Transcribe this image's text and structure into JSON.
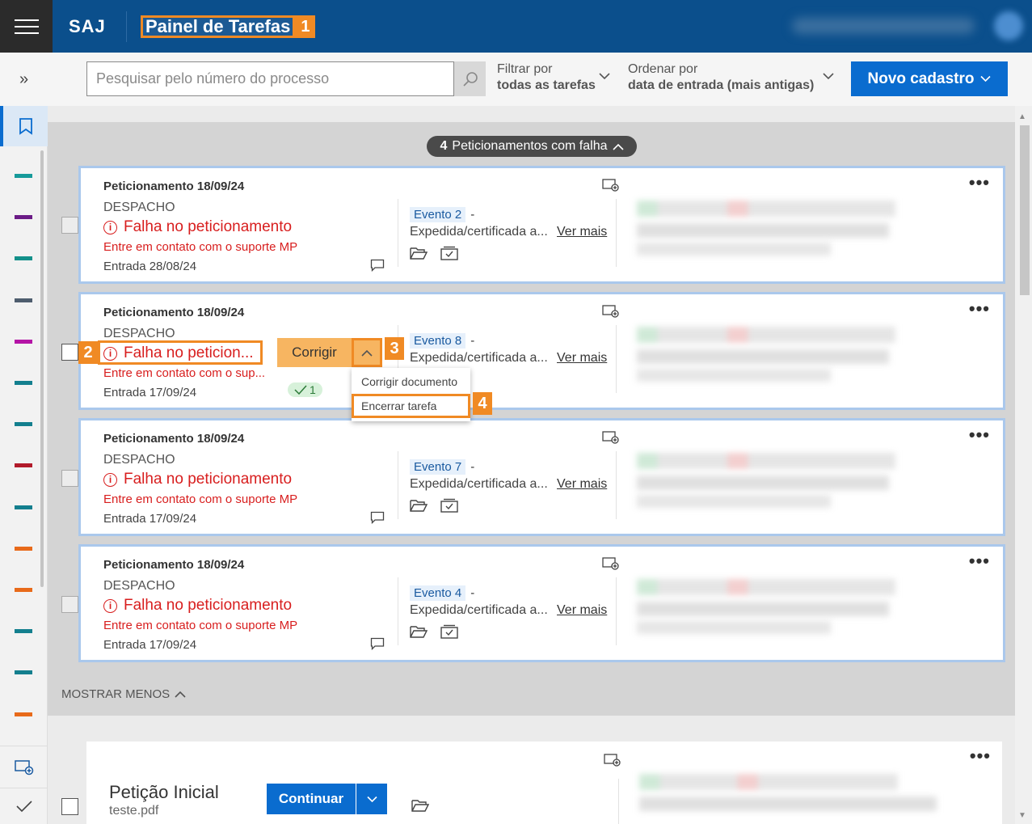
{
  "header": {
    "brand": "SAJ",
    "title": "Painel de Tarefas",
    "title_badge": "1"
  },
  "toolbar": {
    "search_placeholder": "Pesquisar pelo número do processo",
    "filter_label": "Filtrar por",
    "filter_value": "todas as tarefas",
    "order_label": "Ordenar por",
    "order_value": "data de entrada (mais antigas)",
    "new_button": "Novo cadastro"
  },
  "failures_pill": {
    "count": "4",
    "label": "Peticionamentos com falha"
  },
  "cards": [
    {
      "title": "Peticionamento 18/09/24",
      "type": "DESPACHO",
      "error": "Falha no peticionamento",
      "support": "Entre em contato com o suporte MP",
      "entry": "Entrada 28/08/24",
      "event": "Evento 2",
      "description": "Expedida/certificada a...",
      "more": "Ver mais"
    },
    {
      "title": "Peticionamento 18/09/24",
      "type": "DESPACHO",
      "error": "Falha no peticion...",
      "support": "Entre em contato com o sup...",
      "entry": "Entrada 17/09/24",
      "badge": "1",
      "event": "Evento 8",
      "description": "Expedida/certificada a...",
      "more": "Ver mais"
    },
    {
      "title": "Peticionamento 18/09/24",
      "type": "DESPACHO",
      "error": "Falha no peticionamento",
      "support": "Entre em contato com o suporte MP",
      "entry": "Entrada 17/09/24",
      "event": "Evento 7",
      "description": "Expedida/certificada a...",
      "more": "Ver mais"
    },
    {
      "title": "Peticionamento 18/09/24",
      "type": "DESPACHO",
      "error": "Falha no peticionamento",
      "support": "Entre em contato com o suporte MP",
      "entry": "Entrada 17/09/24",
      "event": "Evento 4",
      "description": "Expedida/certificada a...",
      "more": "Ver mais"
    }
  ],
  "step_badges": {
    "two": "2",
    "three": "3",
    "four": "4"
  },
  "corrigir": {
    "label": "Corrigir",
    "menu": [
      "Corrigir documento",
      "Encerrar tarefa"
    ]
  },
  "show_less": "MOSTRAR MENOS",
  "petition": {
    "title": "Petição Inicial",
    "file": "teste.pdf",
    "continue": "Continuar"
  },
  "sidebar": {
    "colors": [
      "#169a9a",
      "#6b1b86",
      "#13908a",
      "#4e5d6e",
      "#b514a6",
      "#137f8e",
      "#137f8e",
      "#b21b2b",
      "#137f8e",
      "#e86a1a",
      "#e86a1a",
      "#137f8e",
      "#137f8e",
      "#e86a1a"
    ]
  }
}
